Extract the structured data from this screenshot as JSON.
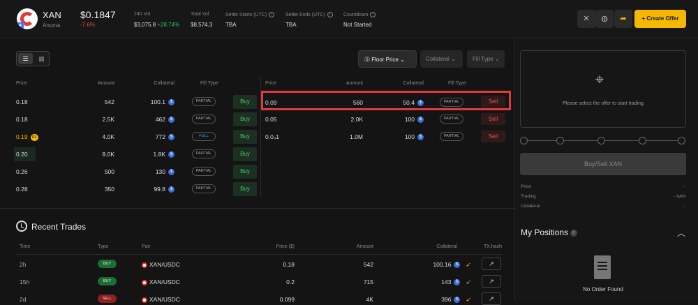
{
  "header": {
    "symbol": "XAN",
    "symbol_sub": "Anoma",
    "price": "$0.1847",
    "change": "-7.6%",
    "stats": [
      {
        "label": "24h Vol",
        "value": "$3,075.8",
        "extra": "+28.74%"
      },
      {
        "label": "Total Vol",
        "value": "$8,574.3"
      },
      {
        "label": "Settle Starts (UTC)",
        "value": "TBA"
      },
      {
        "label": "Settle Ends (UTC)",
        "value": "TBA"
      },
      {
        "label": "Countdown",
        "value": "Not Started"
      }
    ],
    "create_label": "Create Offer"
  },
  "filters": {
    "floor_price": "Floor Price",
    "collateral": "Collateral",
    "fill_type": "Fill Type"
  },
  "buy_book": {
    "headers": [
      "Price",
      "Amount",
      "Collateral",
      "Fill Type"
    ],
    "rows": [
      {
        "price": "0.18",
        "amount": "542",
        "collateral": "100.1",
        "fill": "PARTIAL",
        "action": "Buy"
      },
      {
        "price": "0.18",
        "amount": "2.5K",
        "collateral": "462",
        "fill": "PARTIAL",
        "action": "Buy"
      },
      {
        "price": "0.19",
        "amount": "4.0K",
        "collateral": "772",
        "fill": "FULL",
        "action": "Buy",
        "badge": "RS"
      },
      {
        "price": "0.20",
        "amount": "9.0K",
        "collateral": "1.8K",
        "fill": "PARTIAL",
        "action": "Buy"
      },
      {
        "price": "0.26",
        "amount": "500",
        "collateral": "130",
        "fill": "PARTIAL",
        "action": "Buy"
      },
      {
        "price": "0.28",
        "amount": "350",
        "collateral": "99.8",
        "fill": "PARTIAL",
        "action": "Buy"
      }
    ]
  },
  "sell_book": {
    "headers": [
      "Price",
      "Amount",
      "Collateral",
      "Fill Type"
    ],
    "rows": [
      {
        "price": "0.09",
        "amount": "560",
        "collateral": "50.4",
        "fill": "PARTIAL",
        "action": "Sell"
      },
      {
        "price": "0.05",
        "amount": "2.0K",
        "collateral": "100",
        "fill": "PARTIAL",
        "action": "Sell"
      },
      {
        "price": "0.0₄1",
        "amount": "1.0M",
        "collateral": "100",
        "fill": "PARTIAL",
        "action": "Sell"
      }
    ]
  },
  "recent_trades": {
    "title": "Recent Trades",
    "headers": [
      "Time",
      "Type",
      "Pair",
      "Price ($)",
      "Amount",
      "Collateral",
      "TX.hash"
    ],
    "rows": [
      {
        "time": "2h",
        "type": "BUY",
        "pair": "XAN/USDC",
        "price": "0.18",
        "amount": "542",
        "collateral": "100.16"
      },
      {
        "time": "15h",
        "type": "BUY",
        "pair": "XAN/USDC",
        "price": "0.2",
        "amount": "715",
        "collateral": "143"
      },
      {
        "time": "2d",
        "type": "SELL",
        "pair": "XAN/USDC",
        "price": "0.099",
        "amount": "4K",
        "collateral": "396"
      }
    ]
  },
  "trade_panel": {
    "select_text": "Please select the offer to start trading",
    "action_label": "Buy/Sell XAN",
    "details": [
      {
        "label": "Price",
        "value": "-"
      },
      {
        "label": "Trading",
        "value": "- XAN"
      },
      {
        "label": "Collateral",
        "value": "-"
      }
    ]
  },
  "positions": {
    "title": "My Positions",
    "count": "0",
    "empty_text": "No Order Found"
  }
}
